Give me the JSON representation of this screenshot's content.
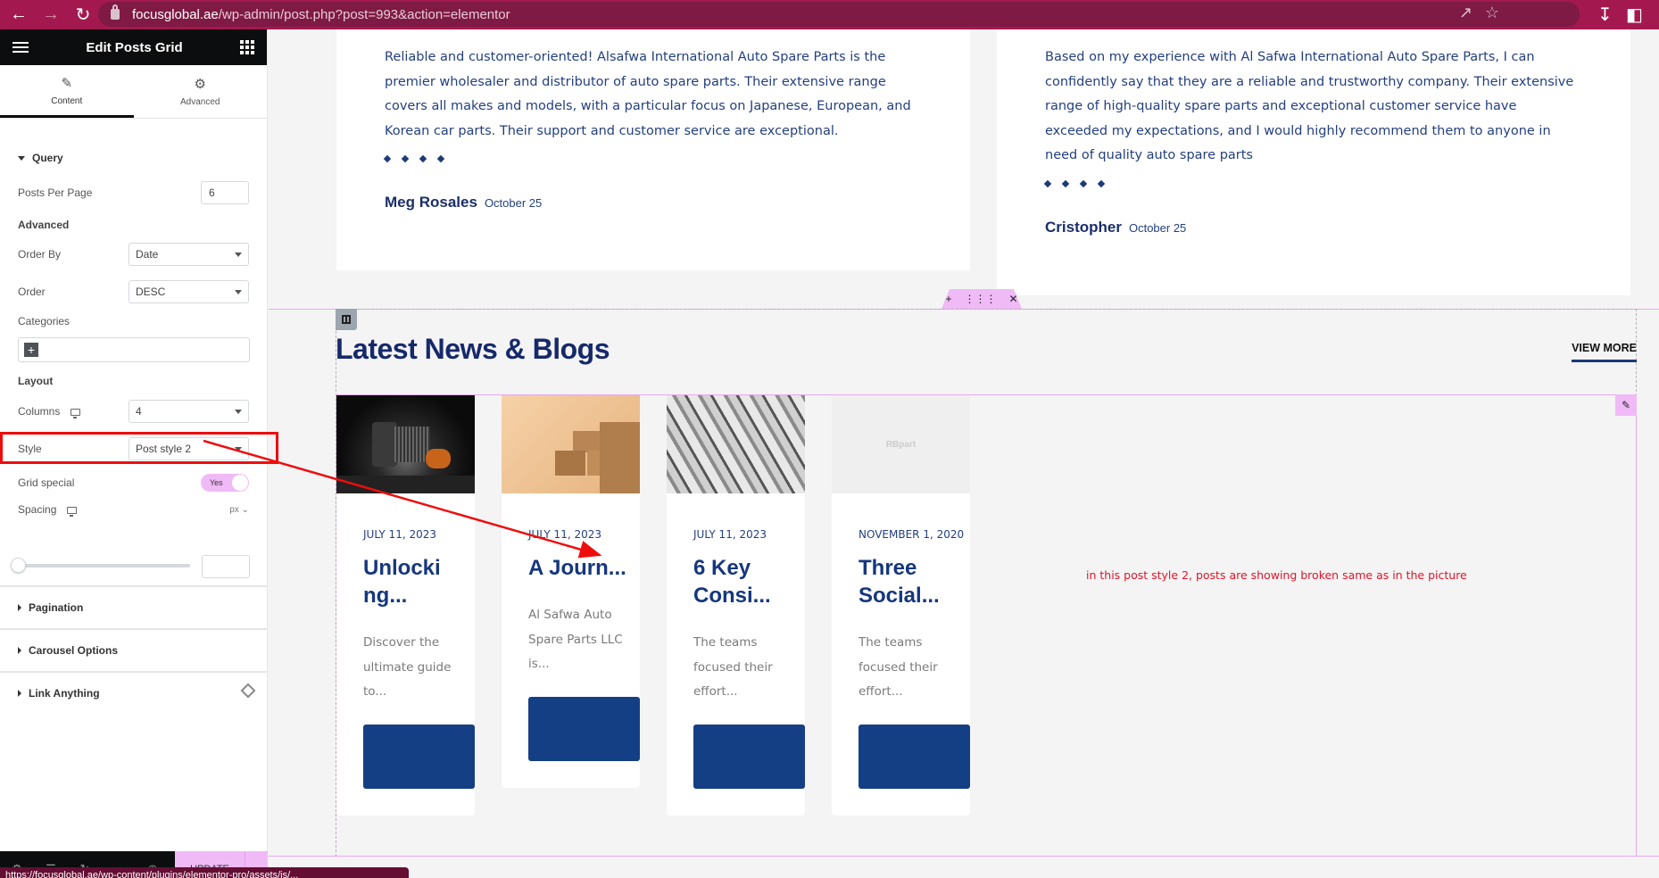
{
  "browser": {
    "url_host": "focusglobal.ae",
    "url_path": "/wp-admin/post.php?post=993&action=elementor",
    "status_url": "https://focusglobal.ae/wp-content/plugins/elementor-pro/assets/js/..."
  },
  "panel": {
    "title": "Edit Posts Grid",
    "tabs": [
      {
        "label": "Content",
        "icon": "pencil-icon",
        "active": true
      },
      {
        "label": "Advanced",
        "icon": "gear-icon",
        "active": false
      }
    ],
    "query": {
      "section_label": "Query",
      "posts_per_page_label": "Posts Per Page",
      "posts_per_page_value": "6",
      "advanced_label": "Advanced",
      "order_by_label": "Order By",
      "order_by_value": "Date",
      "order_label": "Order",
      "order_value": "DESC",
      "categories_label": "Categories",
      "layout_label": "Layout",
      "columns_label": "Columns",
      "columns_value": "4",
      "style_label": "Style",
      "style_value": "Post style 2",
      "grid_special_label": "Grid special",
      "grid_special_value": "Yes",
      "spacing_label": "Spacing",
      "spacing_unit": "px",
      "spacing_value": ""
    },
    "sections": [
      "Pagination",
      "Carousel Options",
      "Link Anything"
    ],
    "footer": {
      "update_label": "UPDATE"
    }
  },
  "testimonials": [
    {
      "text": "Reliable and customer-oriented! Alsafwa International Auto Spare Parts is the premier wholesaler and distributor of auto spare parts. Their extensive range covers all makes and models, with a particular focus on Japanese, European, and Korean car parts. Their support and customer service are exceptional.",
      "rating": 4,
      "author": "Meg Rosales",
      "date": "October 25"
    },
    {
      "text": "Based on my experience with Al Safwa International Auto Spare Parts, I can confidently say that they are a reliable and trustworthy company. Their extensive range of high-quality spare parts and exceptional customer service have exceeded my expectations, and I would highly recommend them to anyone in need of quality auto spare parts",
      "rating": 4,
      "author": "Cristopher",
      "date": "October 25"
    }
  ],
  "blog": {
    "heading": "Latest News & Blogs",
    "view_more": "VIEW MORE",
    "posts": [
      {
        "date": "JULY 11, 2023",
        "title": "Unlocki ng...",
        "excerpt": "Discover the ultimate guide to...",
        "image": "auto-parts-dark"
      },
      {
        "date": "JULY 11, 2023",
        "title": "A Journ...",
        "excerpt": "Al Safwa Auto Spare Parts LLC is...",
        "image": "cardboard-boxes"
      },
      {
        "date": "JULY 11, 2023",
        "title": "6 Key Consi...",
        "excerpt": "The teams focused their effort...",
        "image": "wrenches-tools"
      },
      {
        "date": "NOVEMBER 1, 2020",
        "title": "Three Social...",
        "excerpt": "The teams focused their effort...",
        "image": "placeholder",
        "placeholder_text": "RBpart"
      }
    ]
  },
  "annotation": {
    "note": "in this post style 2, posts are showing broken same as in the picture",
    "color": "#e4142a"
  },
  "colors": {
    "browser_bar": "#a3194f",
    "panel_header": "#0c0d0e",
    "accent_pink": "#f0baf7",
    "brand_navy": "#16296b",
    "button_blue": "#153f84"
  }
}
